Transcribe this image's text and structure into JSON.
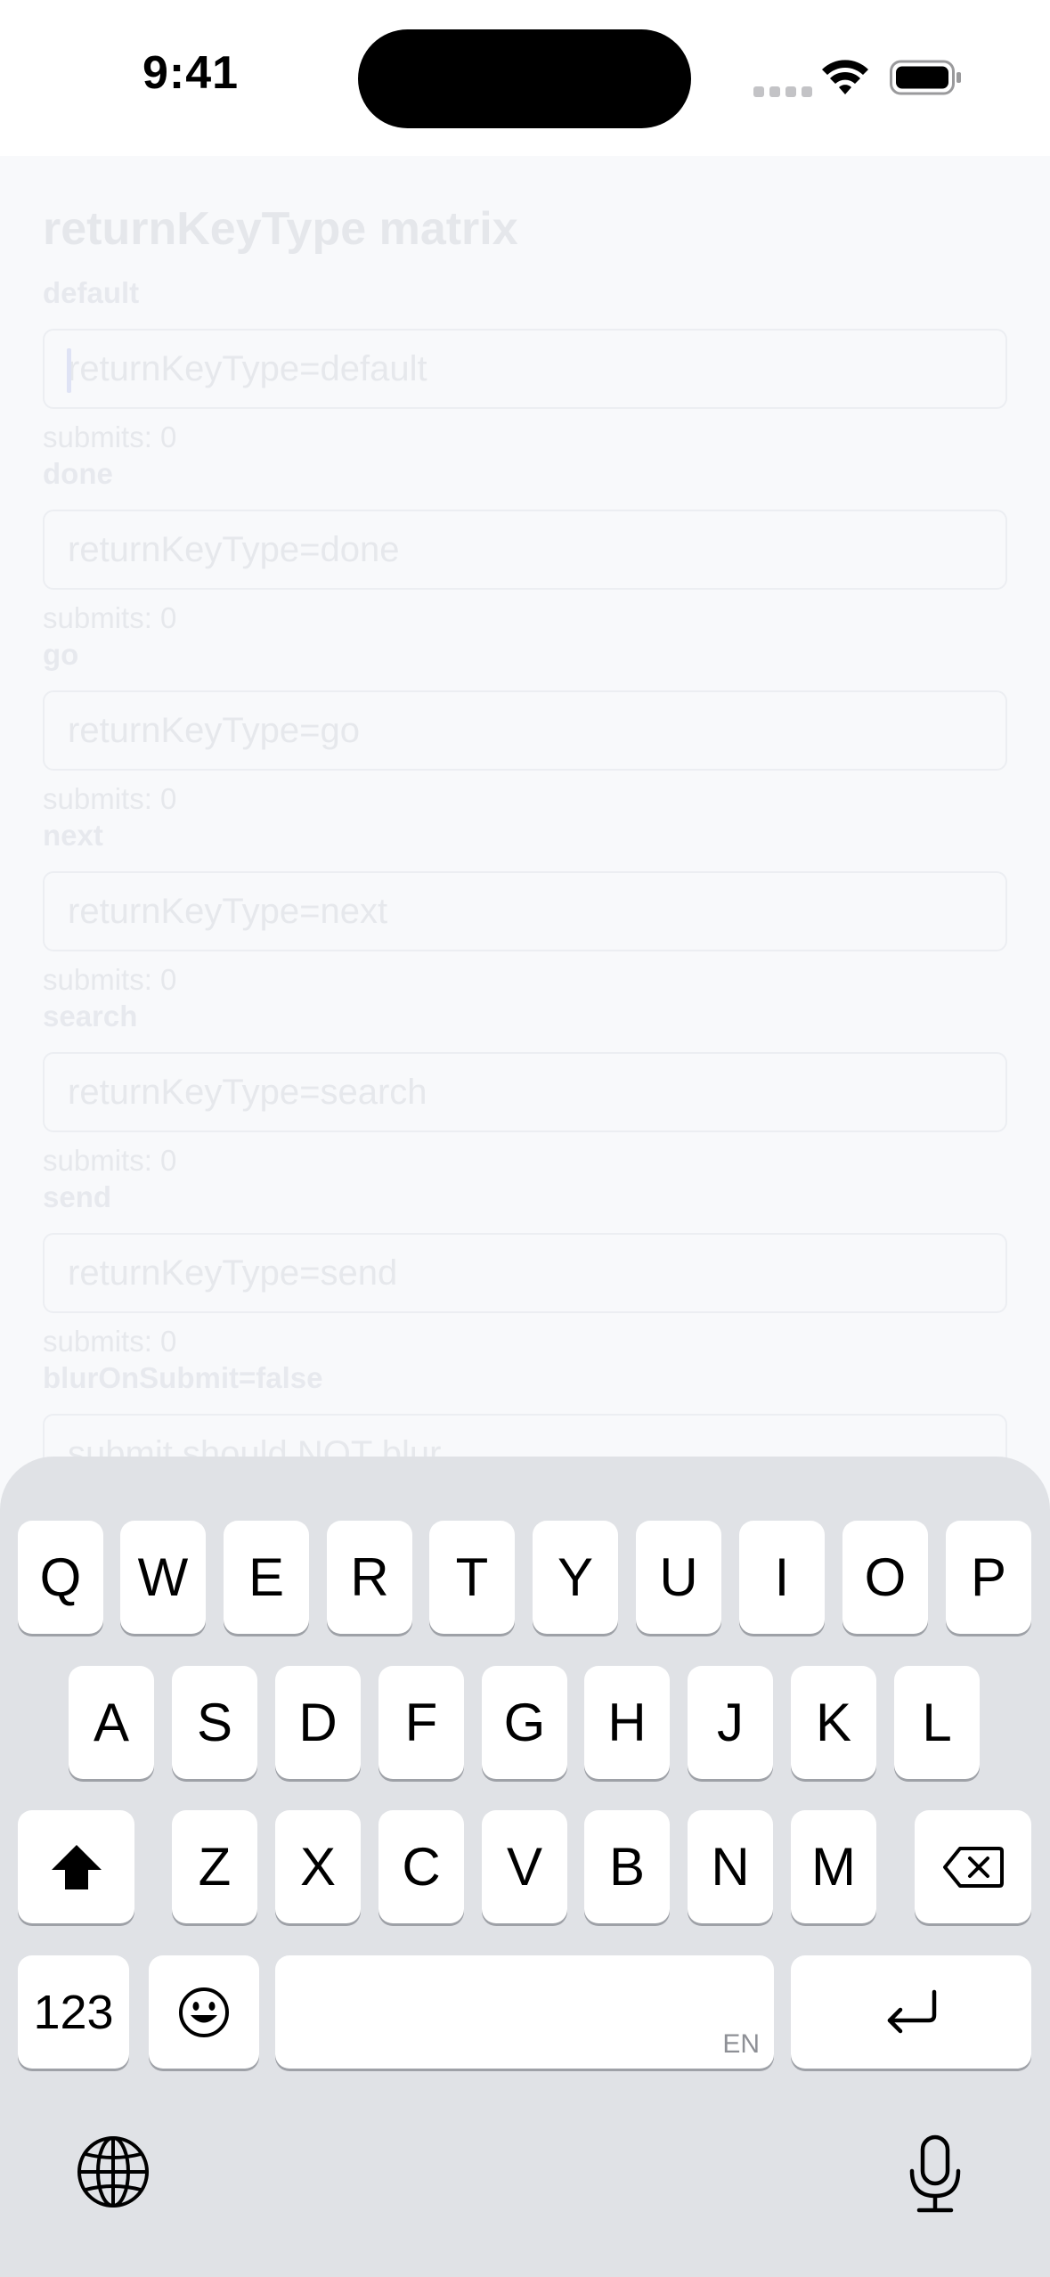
{
  "status_bar": {
    "time": "9:41"
  },
  "screen": {
    "title": "returnKeyType matrix",
    "rows": [
      {
        "label": "default",
        "placeholder": "returnKeyType=default",
        "submits": "submits: 0"
      },
      {
        "label": "done",
        "placeholder": "returnKeyType=done",
        "submits": "submits: 0"
      },
      {
        "label": "go",
        "placeholder": "returnKeyType=go",
        "submits": "submits: 0"
      },
      {
        "label": "next",
        "placeholder": "returnKeyType=next",
        "submits": "submits: 0"
      },
      {
        "label": "search",
        "placeholder": "returnKeyType=search",
        "submits": "submits: 0"
      },
      {
        "label": "send",
        "placeholder": "returnKeyType=send",
        "submits": "submits: 0"
      },
      {
        "label": "blurOnSubmit=false",
        "placeholder": "submit should NOT blur"
      }
    ]
  },
  "keyboard": {
    "row1": [
      "Q",
      "W",
      "E",
      "R",
      "T",
      "Y",
      "U",
      "I",
      "O",
      "P"
    ],
    "row2": [
      "A",
      "S",
      "D",
      "F",
      "G",
      "H",
      "J",
      "K",
      "L"
    ],
    "row3": [
      "Z",
      "X",
      "C",
      "V",
      "B",
      "N",
      "M"
    ],
    "numbers_label": "123",
    "space_lang": "EN",
    "icons": [
      "shift-icon",
      "delete-icon",
      "emoji-icon",
      "return-icon",
      "globe-icon",
      "microphone-icon"
    ]
  }
}
